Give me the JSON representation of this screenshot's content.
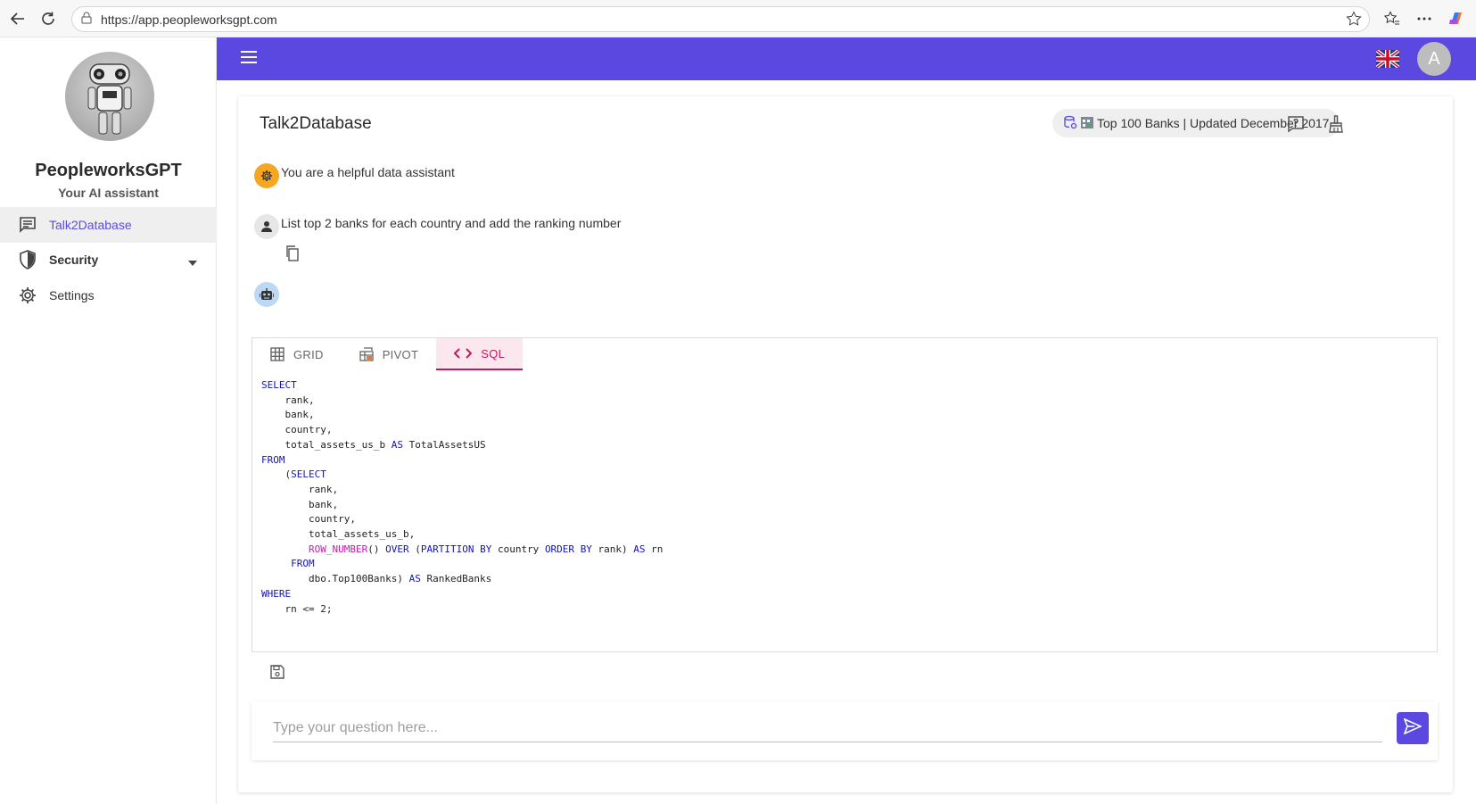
{
  "browser": {
    "url": "https://app.peopleworksgpt.com"
  },
  "sidebar": {
    "brand_name": "PeopleworksGPT",
    "brand_subtitle": "Your AI assistant",
    "items": [
      {
        "label": "Talk2Database",
        "icon": "chat-icon",
        "active": true
      },
      {
        "label": "Security",
        "icon": "shield-icon",
        "active": false
      },
      {
        "label": "Settings",
        "icon": "gear-icon",
        "active": false
      }
    ]
  },
  "appbar": {
    "accent_color": "#5b48e0",
    "language": "flag-uk-icon",
    "user_initial": "A"
  },
  "page": {
    "title": "Talk2Database",
    "datasource": "Top 100 Banks | Updated December 2017"
  },
  "messages": [
    {
      "role": "system",
      "text": "You are a helpful data assistant"
    },
    {
      "role": "user",
      "text": "List top 2 banks for each country and add the ranking number"
    },
    {
      "role": "assistant",
      "text": ""
    }
  ],
  "result": {
    "tabs": [
      {
        "label": "GRID",
        "icon": "grid-icon",
        "active": false
      },
      {
        "label": "PIVOT",
        "icon": "pivot-icon",
        "active": false
      },
      {
        "label": "SQL",
        "icon": "code-icon",
        "active": true
      }
    ],
    "sql_lines": [
      "SELECT",
      "    rank,",
      "    bank,",
      "    country,",
      "    total_assets_us_b AS TotalAssetsUS",
      "FROM",
      "    (SELECT",
      "        rank,",
      "        bank,",
      "        country,",
      "        total_assets_us_b,",
      "        ROW_NUMBER() OVER (PARTITION BY country ORDER BY rank) AS rn",
      "     FROM",
      "        dbo.Top100Banks) AS RankedBanks",
      "WHERE",
      "    rn <= 2;"
    ]
  },
  "input": {
    "placeholder": "Type your question here...",
    "value": ""
  }
}
